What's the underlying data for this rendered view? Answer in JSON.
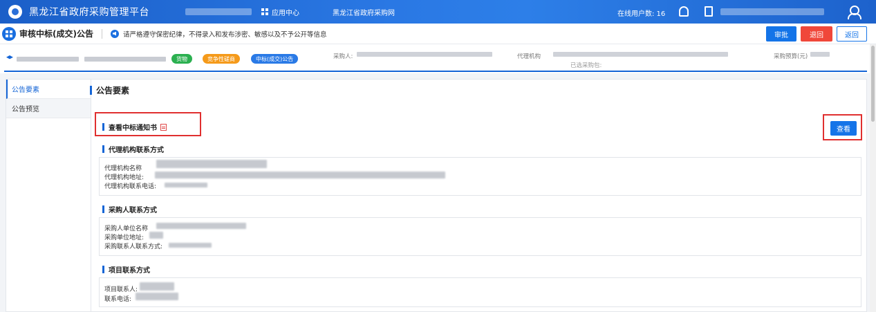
{
  "topbar": {
    "platform_title": "黑龙江省政府采购管理平台",
    "app_center": "应用中心",
    "procurement_site": "黑龙江省政府采购网",
    "online_users_label": "在线用户数: 16"
  },
  "subheader": {
    "page_title": "审核中标(成交)公告",
    "notice": "请严格遵守保密纪律，不得录入和发布涉密、敏感以及不予公开等信息",
    "approve_label": "审批",
    "reject_label": "退回",
    "back_label": "返回"
  },
  "info": {
    "tags": [
      "货物",
      "竞争性磋商",
      "中标(成交)公告"
    ],
    "purchaser_label": "采购人:",
    "agency_label": "代理机构",
    "budget_label": "采购预算(元)",
    "selected_package_label": "已选采购包:"
  },
  "leftnav": {
    "items": [
      {
        "label": "公告要素"
      },
      {
        "label": "公告预览"
      }
    ]
  },
  "main": {
    "section_title": "公告要素",
    "award_notice_title": "查看中标通知书",
    "view_label": "查看",
    "agency_contact": {
      "title": "代理机构联系方式",
      "name_label": "代理机构名称",
      "address_label": "代理机构地址:",
      "phone_label": "代理机构联系电话:"
    },
    "purchaser_contact": {
      "title": "采购人联系方式",
      "name_label": "采购人单位名称",
      "address_label": "采购单位地址:",
      "phone_label": "采购联系人联系方式:"
    },
    "project_contact": {
      "title": "项目联系方式",
      "contact_label": "项目联系人:",
      "phone_label": "联系电话:"
    }
  }
}
